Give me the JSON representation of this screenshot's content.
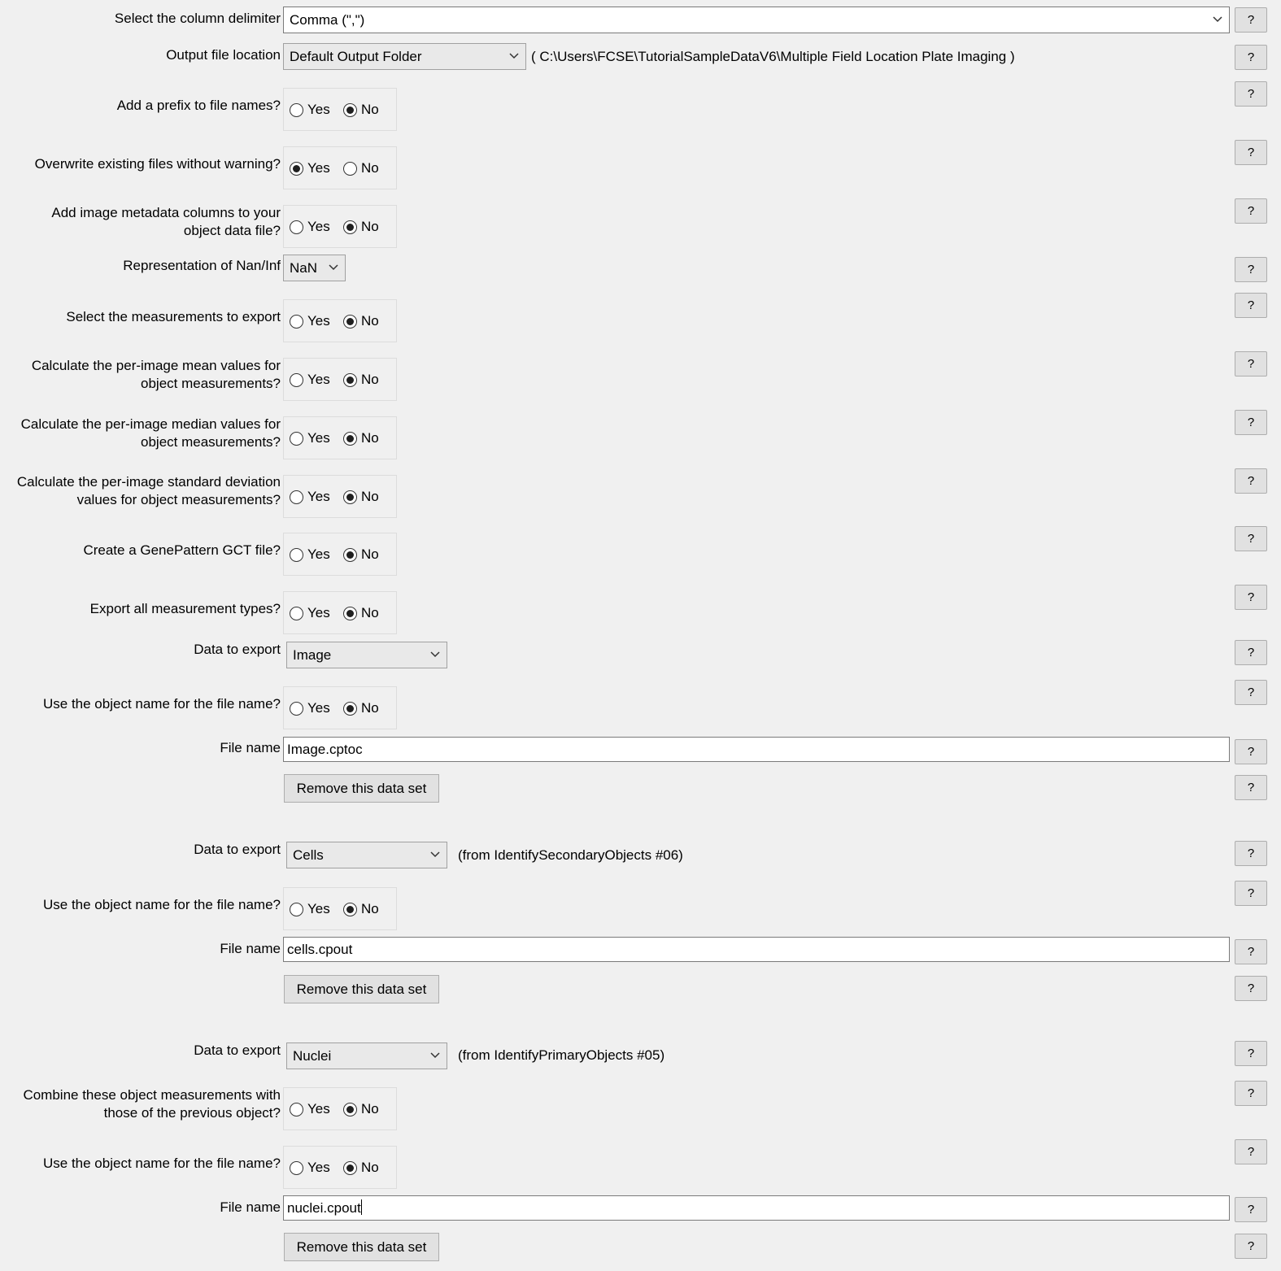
{
  "help_label": "?",
  "yes_label": "Yes",
  "no_label": "No",
  "delimiter": {
    "label": "Select the column delimiter",
    "value": "Comma (\",\")"
  },
  "output": {
    "label": "Output file location",
    "value": "Default Output Folder",
    "path": "( C:\\Users\\FCSE\\TutorialSampleDataV6\\Multiple Field Location Plate Imaging )"
  },
  "prefix": {
    "label": "Add a prefix to file names?",
    "selected": "No"
  },
  "overwrite": {
    "label": "Overwrite existing files without warning?",
    "selected": "Yes"
  },
  "add_metadata": {
    "label_line1": "Add image metadata columns to your",
    "label_line2": "object data file?",
    "selected": "No"
  },
  "nan": {
    "label": "Representation of Nan/Inf",
    "value": "NaN"
  },
  "select_measurements": {
    "label": "Select the measurements to export",
    "selected": "No"
  },
  "mean": {
    "label_line1": "Calculate the per-image mean values for",
    "label_line2": "object measurements?",
    "selected": "No"
  },
  "median": {
    "label_line1": "Calculate the per-image median values for",
    "label_line2": "object measurements?",
    "selected": "No"
  },
  "std": {
    "label_line1": "Calculate the per-image standard deviation",
    "label_line2": "values for object measurements?",
    "selected": "No"
  },
  "gct": {
    "label": "Create a GenePattern GCT file?",
    "selected": "No"
  },
  "export_all": {
    "label": "Export all measurement types?",
    "selected": "No"
  },
  "datasets": [
    {
      "data_label": "Data to export",
      "data_value": "Image",
      "source_note": "",
      "use_name_label": "Use the object name for the file name?",
      "use_name_selected": "No",
      "file_label": "File name",
      "file_value": "Image.cptoc",
      "remove_label": "Remove this data set"
    },
    {
      "data_label": "Data to export",
      "data_value": "Cells",
      "source_note": "(from IdentifySecondaryObjects #06)",
      "use_name_label": "Use the object name for the file name?",
      "use_name_selected": "No",
      "file_label": "File name",
      "file_value": "cells.cpout",
      "remove_label": "Remove this data set"
    },
    {
      "data_label": "Data to export",
      "data_value": "Nuclei",
      "source_note": "(from IdentifyPrimaryObjects #05)",
      "combine_label_line1": "Combine these object measurements with",
      "combine_label_line2": "those of the previous object?",
      "combine_selected": "No",
      "use_name_label": "Use the object name for the file name?",
      "use_name_selected": "No",
      "file_label": "File name",
      "file_value": "nuclei.cpout",
      "remove_label": "Remove this data set"
    }
  ]
}
